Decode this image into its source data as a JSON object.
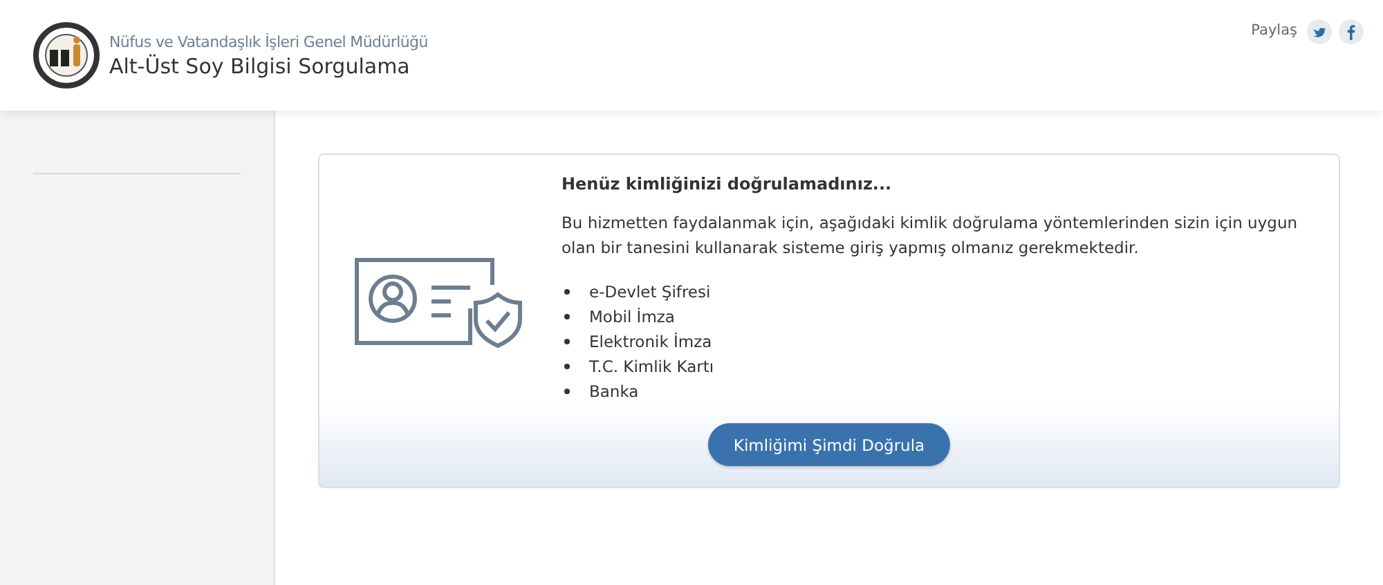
{
  "header": {
    "organization": "Nüfus ve Vatandaşlık İşleri Genel Müdürlüğü",
    "title": "Alt-Üst Soy Bilgisi Sorgulama",
    "share_label": "Paylaş"
  },
  "card": {
    "heading": "Henüz kimliğinizi doğrulamadınız...",
    "description": "Bu hizmetten faydalanmak için, aşağıdaki kimlik doğrulama yöntemlerinden sizin için uygun olan bir tanesini kullanarak sisteme giriş yapmış olmanız gerekmektedir.",
    "methods": [
      "e-Devlet Şifresi",
      "Mobil İmza",
      "Elektronik İmza",
      "T.C. Kimlik Kartı",
      "Banka"
    ],
    "button": "Kimliğimi Şimdi Doğrula"
  }
}
